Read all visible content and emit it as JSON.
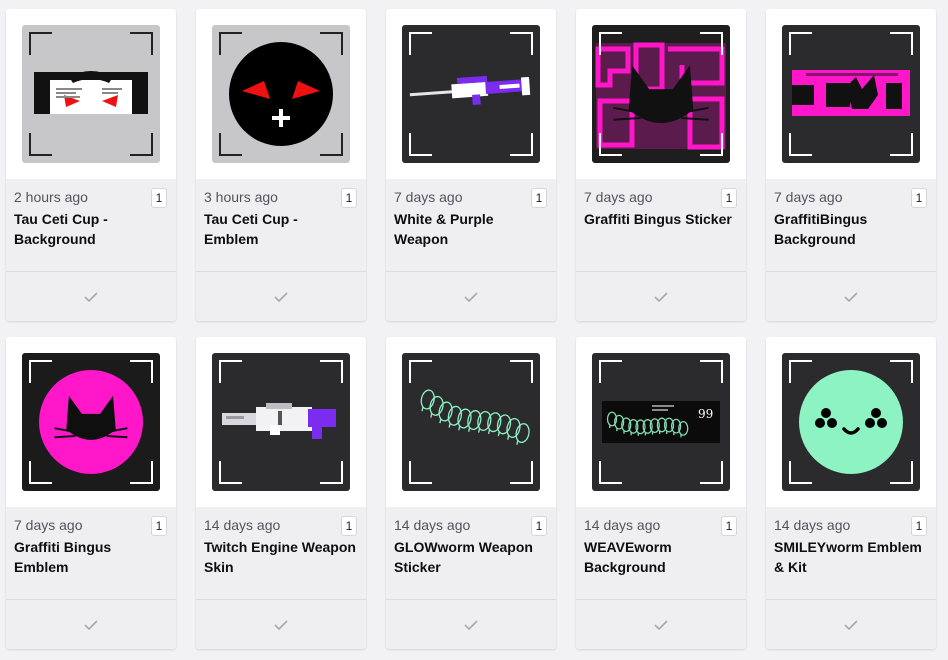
{
  "items": [
    {
      "time": "2 hours ago",
      "count": "1",
      "title": "Tau Ceti Cup - Background",
      "art": "tau-bg"
    },
    {
      "time": "3 hours ago",
      "count": "1",
      "title": "Tau Ceti Cup - Emblem",
      "art": "tau-emblem"
    },
    {
      "time": "7 days ago",
      "count": "1",
      "title": "White & Purple Weapon",
      "art": "rifle"
    },
    {
      "time": "7 days ago",
      "count": "1",
      "title": "Graffiti Bingus Sticker",
      "art": "bingus-sticker"
    },
    {
      "time": "7 days ago",
      "count": "1",
      "title": "GraffitiBingus Background",
      "art": "bingus-bg"
    },
    {
      "time": "7 days ago",
      "count": "1",
      "title": "Graffiti Bingus Emblem",
      "art": "bingus-emblem"
    },
    {
      "time": "14 days ago",
      "count": "1",
      "title": "Twitch Engine Weapon Skin",
      "art": "engine-gun"
    },
    {
      "time": "14 days ago",
      "count": "1",
      "title": "GLOWworm Weapon Sticker",
      "art": "glowworm"
    },
    {
      "time": "14 days ago",
      "count": "1",
      "title": "WEAVEworm Background",
      "art": "weaveworm"
    },
    {
      "time": "14 days ago",
      "count": "1",
      "title": "SMILEYworm Emblem & Kit",
      "art": "smileyworm"
    }
  ],
  "artwork_text": {
    "weaveworm_number": "99"
  },
  "colors": {
    "magenta": "#ff17c9",
    "purple": "#7b2cf0",
    "mint": "#8df3c3",
    "dark_thumb": "#2b2b2e",
    "light_thumb": "#c7c7c9"
  },
  "icons": {
    "select": "checkmark-icon"
  }
}
